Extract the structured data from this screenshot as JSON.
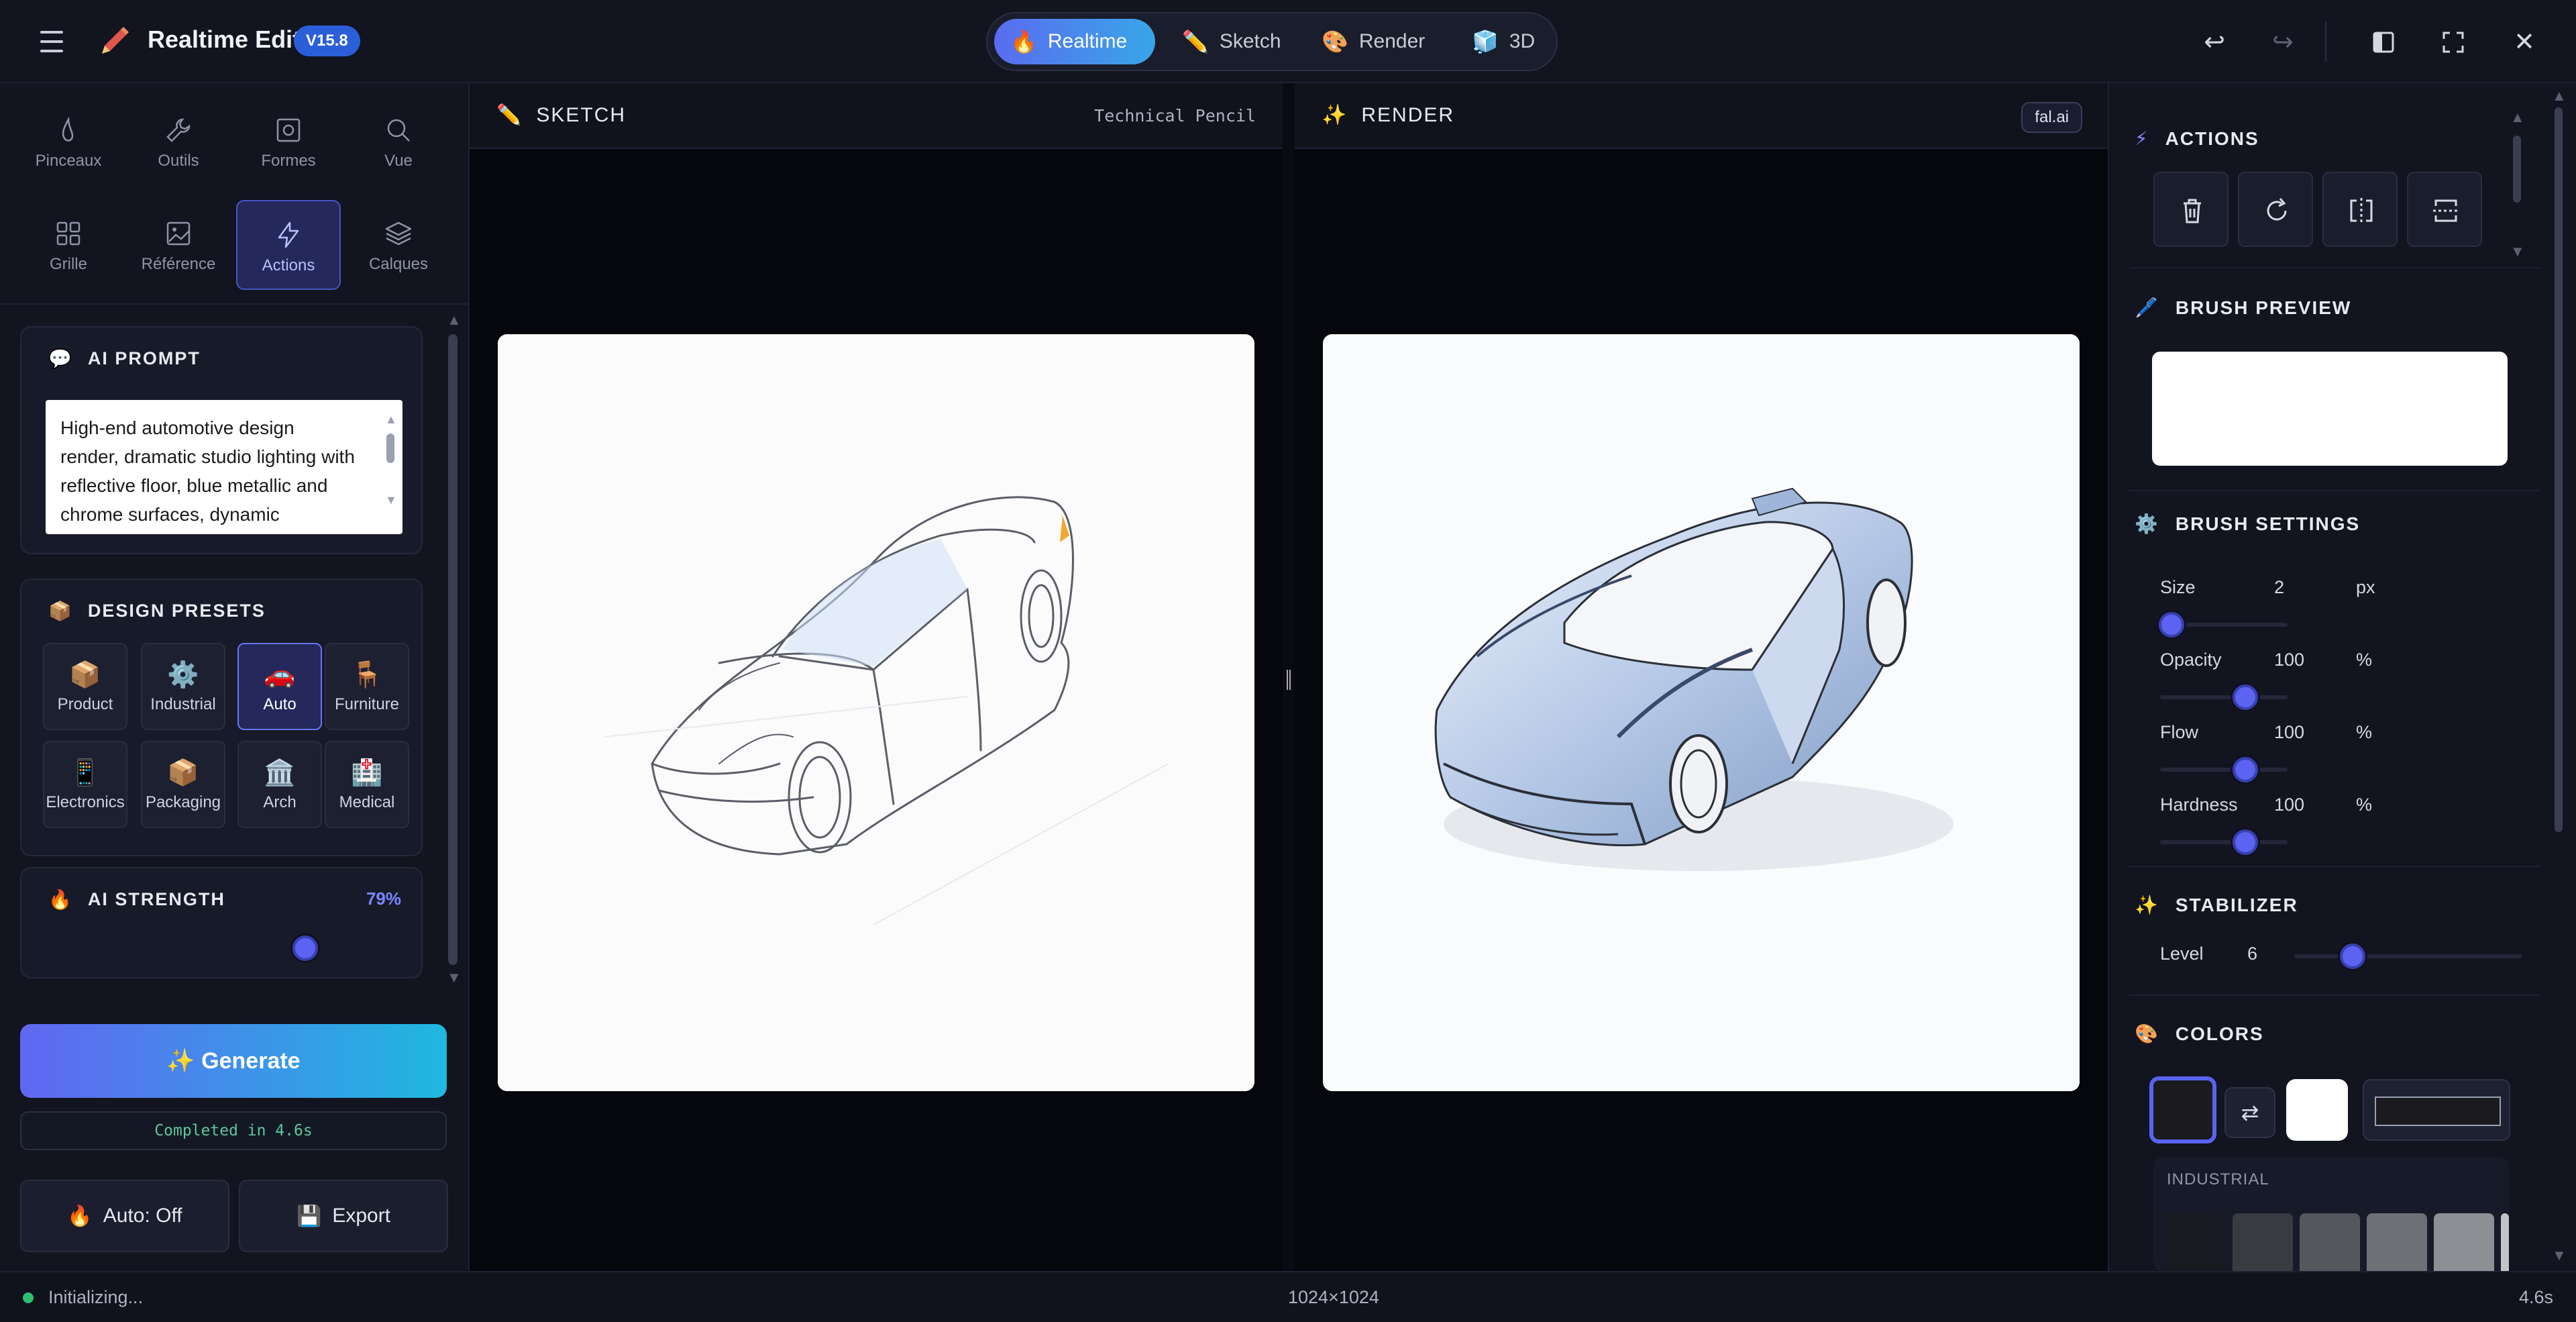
{
  "app": {
    "title": "Realtime Edit",
    "version": "V15.8"
  },
  "modes": [
    {
      "label": "Realtime",
      "icon": "flame-icon",
      "active": true
    },
    {
      "label": "Sketch",
      "icon": "pencil-icon",
      "active": false
    },
    {
      "label": "Render",
      "icon": "palette-icon",
      "active": false
    },
    {
      "label": "3D",
      "icon": "cube-icon",
      "active": false
    }
  ],
  "tools": [
    {
      "label": "Pinceaux",
      "icon": "brush-icon"
    },
    {
      "label": "Outils",
      "icon": "wrench-icon"
    },
    {
      "label": "Formes",
      "icon": "shape-icon"
    },
    {
      "label": "Vue",
      "icon": "search-icon"
    },
    {
      "label": "Grille",
      "icon": "grid-icon"
    },
    {
      "label": "Référence",
      "icon": "image-icon"
    },
    {
      "label": "Actions",
      "icon": "lightning-icon",
      "active": true
    },
    {
      "label": "Calques",
      "icon": "layers-icon"
    }
  ],
  "ai_prompt": {
    "title": "AI PROMPT",
    "text": "High-end automotive design render, dramatic studio lighting with reflective floor, blue metallic and chrome surfaces, dynamic"
  },
  "presets": {
    "title": "DESIGN PRESETS",
    "items": [
      {
        "label": "Product",
        "icon": "box-icon"
      },
      {
        "label": "Industrial",
        "icon": "gear-icon"
      },
      {
        "label": "Auto",
        "icon": "car-icon",
        "active": true
      },
      {
        "label": "Furniture",
        "icon": "chair-icon"
      },
      {
        "label": "Electronics",
        "icon": "phone-icon"
      },
      {
        "label": "Packaging",
        "icon": "package-icon"
      },
      {
        "label": "Arch",
        "icon": "building-icon"
      },
      {
        "label": "Medical",
        "icon": "medical-icon"
      }
    ]
  },
  "ai_strength": {
    "title": "AI STRENGTH",
    "value_label": "79%",
    "value": 0.79
  },
  "generate": {
    "label": "✨ Generate",
    "status": "Completed in 4.6s"
  },
  "bottom_buttons": {
    "auto": "Auto: Off",
    "export": "Export"
  },
  "sketch_pane": {
    "title": "SKETCH",
    "tool": "Technical Pencil"
  },
  "render_pane": {
    "title": "RENDER",
    "provider": "fal.ai"
  },
  "right": {
    "actions_title": "ACTIONS",
    "brush_preview_title": "BRUSH PREVIEW",
    "brush_settings_title": "BRUSH SETTINGS",
    "settings": [
      {
        "label": "Size",
        "value": "2",
        "unit": "px",
        "level": 0.0
      },
      {
        "label": "Opacity",
        "value": "100",
        "unit": "%",
        "level": 1.0
      },
      {
        "label": "Flow",
        "value": "100",
        "unit": "%",
        "level": 1.0
      },
      {
        "label": "Hardness",
        "value": "100",
        "unit": "%",
        "level": 1.0
      }
    ],
    "stabilizer_title": "STABILIZER",
    "stabilizer": {
      "label": "Level",
      "value": "6",
      "level": 0.3
    },
    "colors_title": "COLORS",
    "palette_title": "INDUSTRIAL",
    "palette": [
      "#1a1b20",
      "#3a3b40",
      "#56575c",
      "#6f7075",
      "#8e8f94",
      "#c3c4c8"
    ],
    "accent": "#5b63f0"
  },
  "status": {
    "state": "Initializing...",
    "resolution": "1024×1024",
    "time": "4.6s"
  }
}
